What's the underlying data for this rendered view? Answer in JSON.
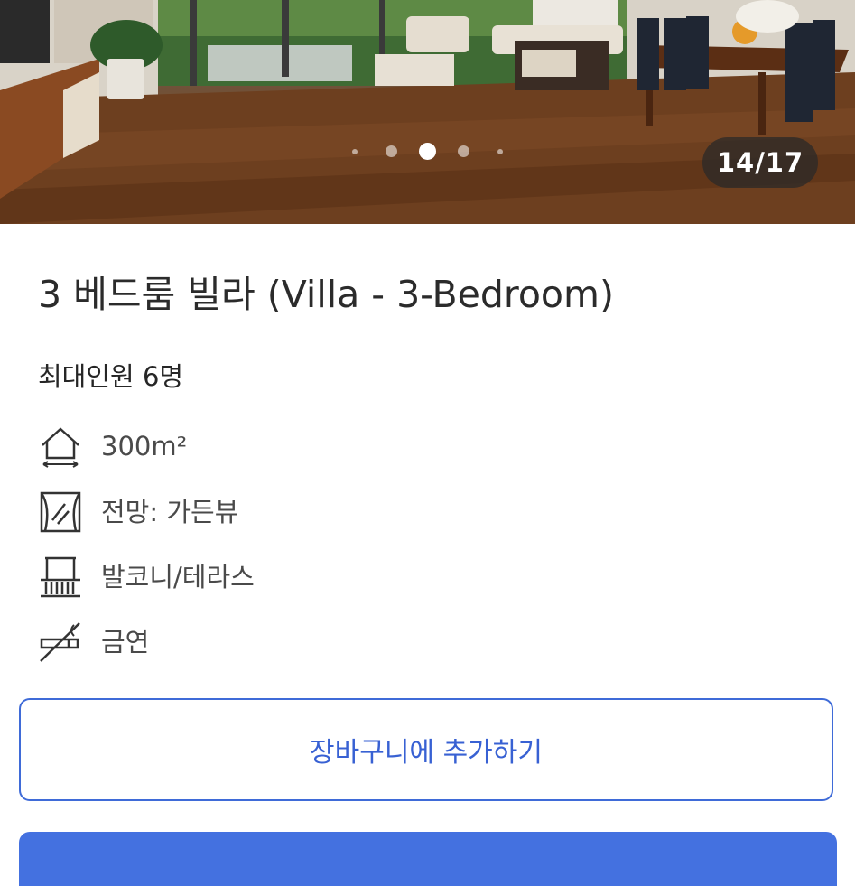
{
  "gallery": {
    "counter": "14/17",
    "current_index": 14,
    "total": 17
  },
  "room": {
    "title": "3 베드룸 빌라 (Villa - 3-Bedroom)",
    "max_occupancy": "최대인원 6명"
  },
  "amenities": [
    {
      "icon": "area-house-icon",
      "label": "300m²"
    },
    {
      "icon": "window-view-icon",
      "label": "전망: 가든뷰"
    },
    {
      "icon": "balcony-icon",
      "label": "발코니/테라스"
    },
    {
      "icon": "no-smoking-icon",
      "label": "금연"
    }
  ],
  "actions": {
    "add_to_cart": "장바구니에 추가하기"
  },
  "colors": {
    "accent": "#3f6bd8",
    "primary_button": "#4471e0",
    "text": "#262626"
  }
}
